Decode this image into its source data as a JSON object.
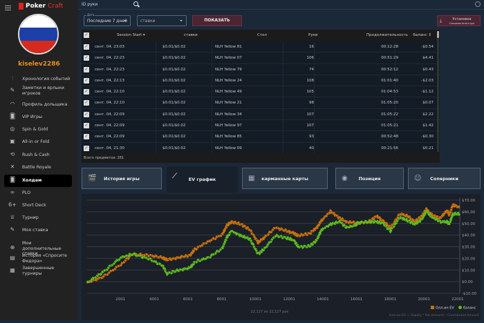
{
  "app": {
    "logo_left": "Poker",
    "logo_right": "Craft",
    "username": "kiselev2286",
    "flag_colors": [
      "#ffffff",
      "#1c3fa8",
      "#d52b1e"
    ]
  },
  "sidebar": {
    "items": [
      {
        "label": "Хронология событий",
        "icon": "timeline-icon"
      },
      {
        "label": "Заметки и ярлыки игроков",
        "icon": "notes-icon"
      },
      {
        "label": "Профиль дольщика",
        "icon": "gauge-icon"
      },
      {
        "label": "VIP Игры",
        "icon": "cards-icon"
      },
      {
        "label": "Spin & Gold",
        "icon": "spin-icon"
      },
      {
        "label": "All-in or Fold",
        "icon": "allin-icon"
      },
      {
        "label": "Rush & Cash",
        "icon": "rush-icon"
      },
      {
        "label": "Battle Royale",
        "icon": "swords-icon"
      },
      {
        "label": "Холдем",
        "icon": "cards-icon",
        "active": true
      },
      {
        "label": "PLO",
        "icon": "plo-icon"
      },
      {
        "label": "Short Deck",
        "icon": "six-plus-icon"
      },
      {
        "label": "Турнир",
        "icon": "trophy-icon"
      },
      {
        "label": "Моя ставка",
        "icon": "stake-icon"
      },
      {
        "label": "Мои дополнительные ставки",
        "icon": "extra-stake-icon"
      },
      {
        "label": "История «Спросите Федора»",
        "icon": "history-icon"
      },
      {
        "label": "Завершенные турниры",
        "icon": "finished-icon"
      }
    ]
  },
  "topbar": {
    "hand_id_label": "ID руки"
  },
  "filters": {
    "date_label": "Дата",
    "date_value": "Последние 7 дней",
    "stakes_value": "ставки",
    "show_button": "ПОКАЗАТЬ",
    "install_button": "Установка",
    "install_sub": "Слишком много рук"
  },
  "table": {
    "headers": [
      "Session Start",
      "ставки",
      "Стол",
      "Руки",
      "Продолжительность",
      "баланс"
    ],
    "rows": [
      [
        "сент. 04, 23:03",
        "$0.01/$0.02",
        "NLH Yellow 81",
        "16",
        "00:12:28",
        "-$0.54"
      ],
      [
        "сент. 04, 22:23",
        "$0.01/$0.02",
        "NLH Yellow 07",
        "106",
        "00:51:29",
        "$4.41"
      ],
      [
        "сент. 04, 22:23",
        "$0.01/$0.02",
        "NLH Yellow 79",
        "74",
        "00:52:12",
        "$0.43"
      ],
      [
        "сент. 04, 22:13",
        "$0.01/$0.02",
        "NLH Yellow 24",
        "108",
        "01:01:40",
        "-$2.03"
      ],
      [
        "сент. 04, 22:10",
        "$0.01/$0.02",
        "NLH Yellow 49",
        "105",
        "01:04:53",
        "-$1.12"
      ],
      [
        "сент. 04, 22:10",
        "$0.01/$0.02",
        "NLH Yellow 21",
        "98",
        "01:05:20",
        "$0.07"
      ],
      [
        "сент. 04, 22:09",
        "$0.01/$0.02",
        "NLH Yellow 34",
        "107",
        "01:05:22",
        "$2.22"
      ],
      [
        "сент. 04, 22:09",
        "$0.01/$0.02",
        "NLH Yellow 97",
        "107",
        "01:05:21",
        "$1.42"
      ],
      [
        "сент. 04, 22:09",
        "$0.01/$0.02",
        "NLH Yellow 85",
        "93",
        "00:52:48",
        "-$0.30"
      ],
      [
        "сент. 04, 21:30",
        "$0.01/$0.02",
        "NLH Yellow 09",
        "40",
        "00:21:56",
        "$0.21"
      ]
    ],
    "footer": "Всего предметов: 281"
  },
  "tabs": [
    {
      "label": "История игры",
      "icon": "clapperboard-icon"
    },
    {
      "label": "EV график",
      "icon": "line-chart-icon",
      "active": true
    },
    {
      "label": "карманные карты",
      "icon": "grid-icon"
    },
    {
      "label": "Позиция",
      "icon": "position-icon"
    },
    {
      "label": "Соперники",
      "icon": "opponent-icon"
    }
  ],
  "chart_data": {
    "type": "line",
    "xlim": [
      0,
      22127
    ],
    "ylim": [
      -10,
      70
    ],
    "x_ticks": [
      "2001",
      "4001",
      "6001",
      "8001",
      "10001",
      "12001",
      "14001",
      "16001",
      "18001",
      "20001",
      "22001"
    ],
    "y_ticks": [
      "$70.00",
      "$60.00",
      "$50.00",
      "$40.00",
      "$30.00",
      "$20.00",
      "$10.00",
      "$0.00",
      "-$10.00"
    ],
    "grid": true,
    "legend_position": "bottom-right",
    "series": [
      {
        "name": "Олл-ин EV",
        "color": "#c8700f",
        "points": [
          [
            0,
            -1
          ],
          [
            935,
            3.9
          ],
          [
            2030,
            14.8
          ],
          [
            2710,
            23.7
          ],
          [
            3670,
            22.7
          ],
          [
            4490,
            20.7
          ],
          [
            4760,
            18.8
          ],
          [
            5450,
            20.7
          ],
          [
            6130,
            22.7
          ],
          [
            6400,
            27.7
          ],
          [
            7220,
            34.6
          ],
          [
            8040,
            40.5
          ],
          [
            8320,
            48.4
          ],
          [
            8590,
            51.4
          ],
          [
            9140,
            49.4
          ],
          [
            9680,
            44.5
          ],
          [
            10160,
            33.6
          ],
          [
            10500,
            37.5
          ],
          [
            11190,
            46.4
          ],
          [
            11870,
            43.5
          ],
          [
            12280,
            41.5
          ],
          [
            12550,
            39.5
          ],
          [
            13230,
            41.5
          ],
          [
            13640,
            46.4
          ],
          [
            13920,
            52.4
          ],
          [
            14460,
            60.3
          ],
          [
            15010,
            54.5
          ],
          [
            15420,
            51.4
          ],
          [
            15970,
            50.4
          ],
          [
            16720,
            51.4
          ],
          [
            17200,
            56.3
          ],
          [
            17540,
            52.4
          ],
          [
            18020,
            46.4
          ],
          [
            18570,
            58.2
          ],
          [
            19040,
            56.3
          ],
          [
            19460,
            51.4
          ],
          [
            19870,
            56.3
          ],
          [
            20140,
            62.2
          ],
          [
            20480,
            57.3
          ],
          [
            20960,
            54.5
          ],
          [
            21370,
            61.2
          ],
          [
            21510,
            57.3
          ],
          [
            21710,
            66
          ],
          [
            22127,
            64
          ]
        ]
      },
      {
        "name": "баланс",
        "color": "#5dbb1e",
        "points": [
          [
            0,
            -1
          ],
          [
            935,
            7.9
          ],
          [
            2030,
            20.7
          ],
          [
            2710,
            23.7
          ],
          [
            3670,
            19.8
          ],
          [
            4490,
            13.8
          ],
          [
            4760,
            6.9
          ],
          [
            5450,
            9.9
          ],
          [
            6130,
            11.9
          ],
          [
            6400,
            16.8
          ],
          [
            7220,
            20.7
          ],
          [
            8040,
            28.6
          ],
          [
            8320,
            38.5
          ],
          [
            8590,
            43.5
          ],
          [
            9140,
            39.5
          ],
          [
            9680,
            36.6
          ],
          [
            10160,
            23.7
          ],
          [
            10500,
            27.7
          ],
          [
            11190,
            39.5
          ],
          [
            11870,
            37.5
          ],
          [
            12280,
            35.6
          ],
          [
            12550,
            29.7
          ],
          [
            13230,
            30.6
          ],
          [
            13640,
            35.6
          ],
          [
            13920,
            44.5
          ],
          [
            14460,
            49.4
          ],
          [
            15010,
            51.4
          ],
          [
            15420,
            46.4
          ],
          [
            15970,
            48.4
          ],
          [
            16040,
            50.4
          ],
          [
            16720,
            51.4
          ],
          [
            17200,
            51.4
          ],
          [
            17540,
            50.4
          ],
          [
            18020,
            43.5
          ],
          [
            18570,
            55.3
          ],
          [
            19040,
            52.4
          ],
          [
            19460,
            49.4
          ],
          [
            19870,
            53.4
          ],
          [
            20140,
            60.3
          ],
          [
            20480,
            55.3
          ],
          [
            20960,
            51.4
          ],
          [
            21370,
            51.4
          ],
          [
            21510,
            49.4
          ],
          [
            21710,
            58.2
          ],
          [
            22127,
            58.2
          ]
        ]
      }
    ],
    "hands_label": "22,127 из 22,127 рук",
    "note": "Олл-ин EV = (Equity * Pot Amount) - Contributed Amount"
  }
}
